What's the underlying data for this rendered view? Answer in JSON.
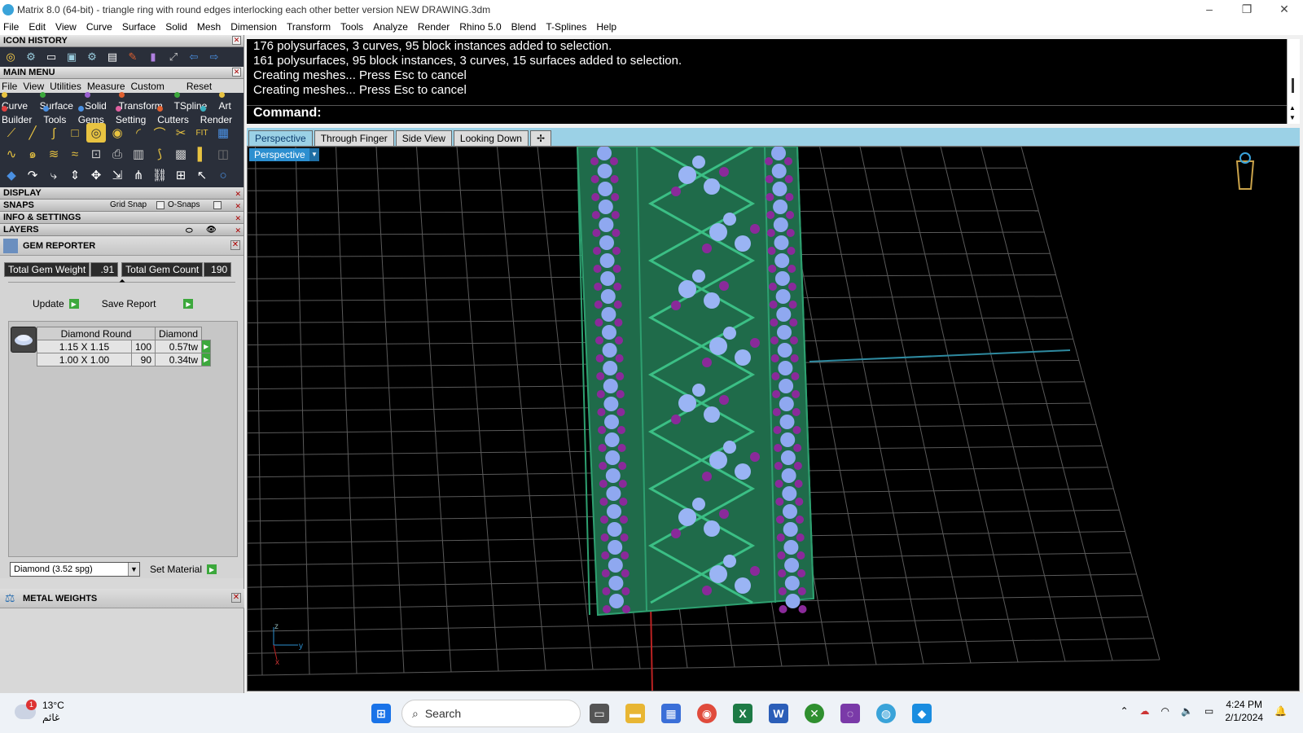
{
  "window": {
    "title": "Matrix 8.0 (64-bit) - triangle ring with round edges interlocking each other better version NEW DRAWING.3dm"
  },
  "menu": [
    "File",
    "Edit",
    "View",
    "Curve",
    "Surface",
    "Solid",
    "Mesh",
    "Dimension",
    "Transform",
    "Tools",
    "Analyze",
    "Render",
    "Rhino 5.0",
    "Blend",
    "T-Splines",
    "Help"
  ],
  "left": {
    "icon_history": "ICON HISTORY",
    "main_menu": "MAIN MENU",
    "main_menu_items": [
      "File",
      "View",
      "Utilities",
      "Measure",
      "Custom"
    ],
    "reset": "Reset",
    "category_row1": [
      {
        "label": "Curve",
        "color": "#e8c341"
      },
      {
        "label": "Surface",
        "color": "#3ca83c"
      },
      {
        "label": "Solid",
        "color": "#9a5fd0"
      },
      {
        "label": "Transform",
        "color": "#e06030"
      },
      {
        "label": "TSpline",
        "color": "#3ca83c"
      },
      {
        "label": "Art",
        "color": "#e8c341"
      }
    ],
    "category_row2": [
      {
        "label": "Builder",
        "color": "#e04040"
      },
      {
        "label": "Tools",
        "color": "#4a90e2"
      },
      {
        "label": "Gems",
        "color": "#4a90e2"
      },
      {
        "label": "Setting",
        "color": "#e060a0"
      },
      {
        "label": "Cutters",
        "color": "#e06030"
      },
      {
        "label": "Render",
        "color": "#3ab0c0"
      }
    ],
    "display": "DISPLAY",
    "snaps": "SNAPS",
    "grid_snap": "Grid Snap",
    "o_snaps": "O-Snaps",
    "info_settings": "INFO & SETTINGS",
    "layers": "LAYERS",
    "gem_reporter": "GEM REPORTER",
    "total_gem_weight_label": "Total Gem Weight",
    "total_gem_weight": ".91",
    "total_gem_count_label": "Total Gem Count",
    "total_gem_count": "190",
    "update": "Update",
    "save_report": "Save Report",
    "table_headers": [
      "Diamond Round",
      "Diamond"
    ],
    "rows": [
      {
        "size": "1.15 X 1.15",
        "count": "100",
        "weight": "0.57tw"
      },
      {
        "size": "1.00 X 1.00",
        "count": "90",
        "weight": "0.34tw"
      }
    ],
    "material": "Diamond     (3.52 spg)",
    "set_material": "Set Material",
    "metal_weights": "METAL WEIGHTS"
  },
  "command": {
    "lines": [
      "176 polysurfaces, 3 curves, 95 block instances added to selection.",
      "161 polysurfaces, 95 block instances, 3 curves, 15 surfaces added to selection.",
      "Creating meshes... Press Esc to cancel",
      "Creating meshes... Press Esc to cancel"
    ],
    "prompt": "Command:"
  },
  "tabs": [
    "Perspective",
    "Through Finger",
    "Side View",
    "Looking Down"
  ],
  "viewport": {
    "label": "Perspective",
    "axis_x": "x",
    "axis_y": "y",
    "axis_z": "z"
  },
  "taskbar": {
    "temp": "13°C",
    "weather": "غائم",
    "badge": "1",
    "search": "Search",
    "time": "4:24 PM",
    "date": "2/1/2024"
  }
}
